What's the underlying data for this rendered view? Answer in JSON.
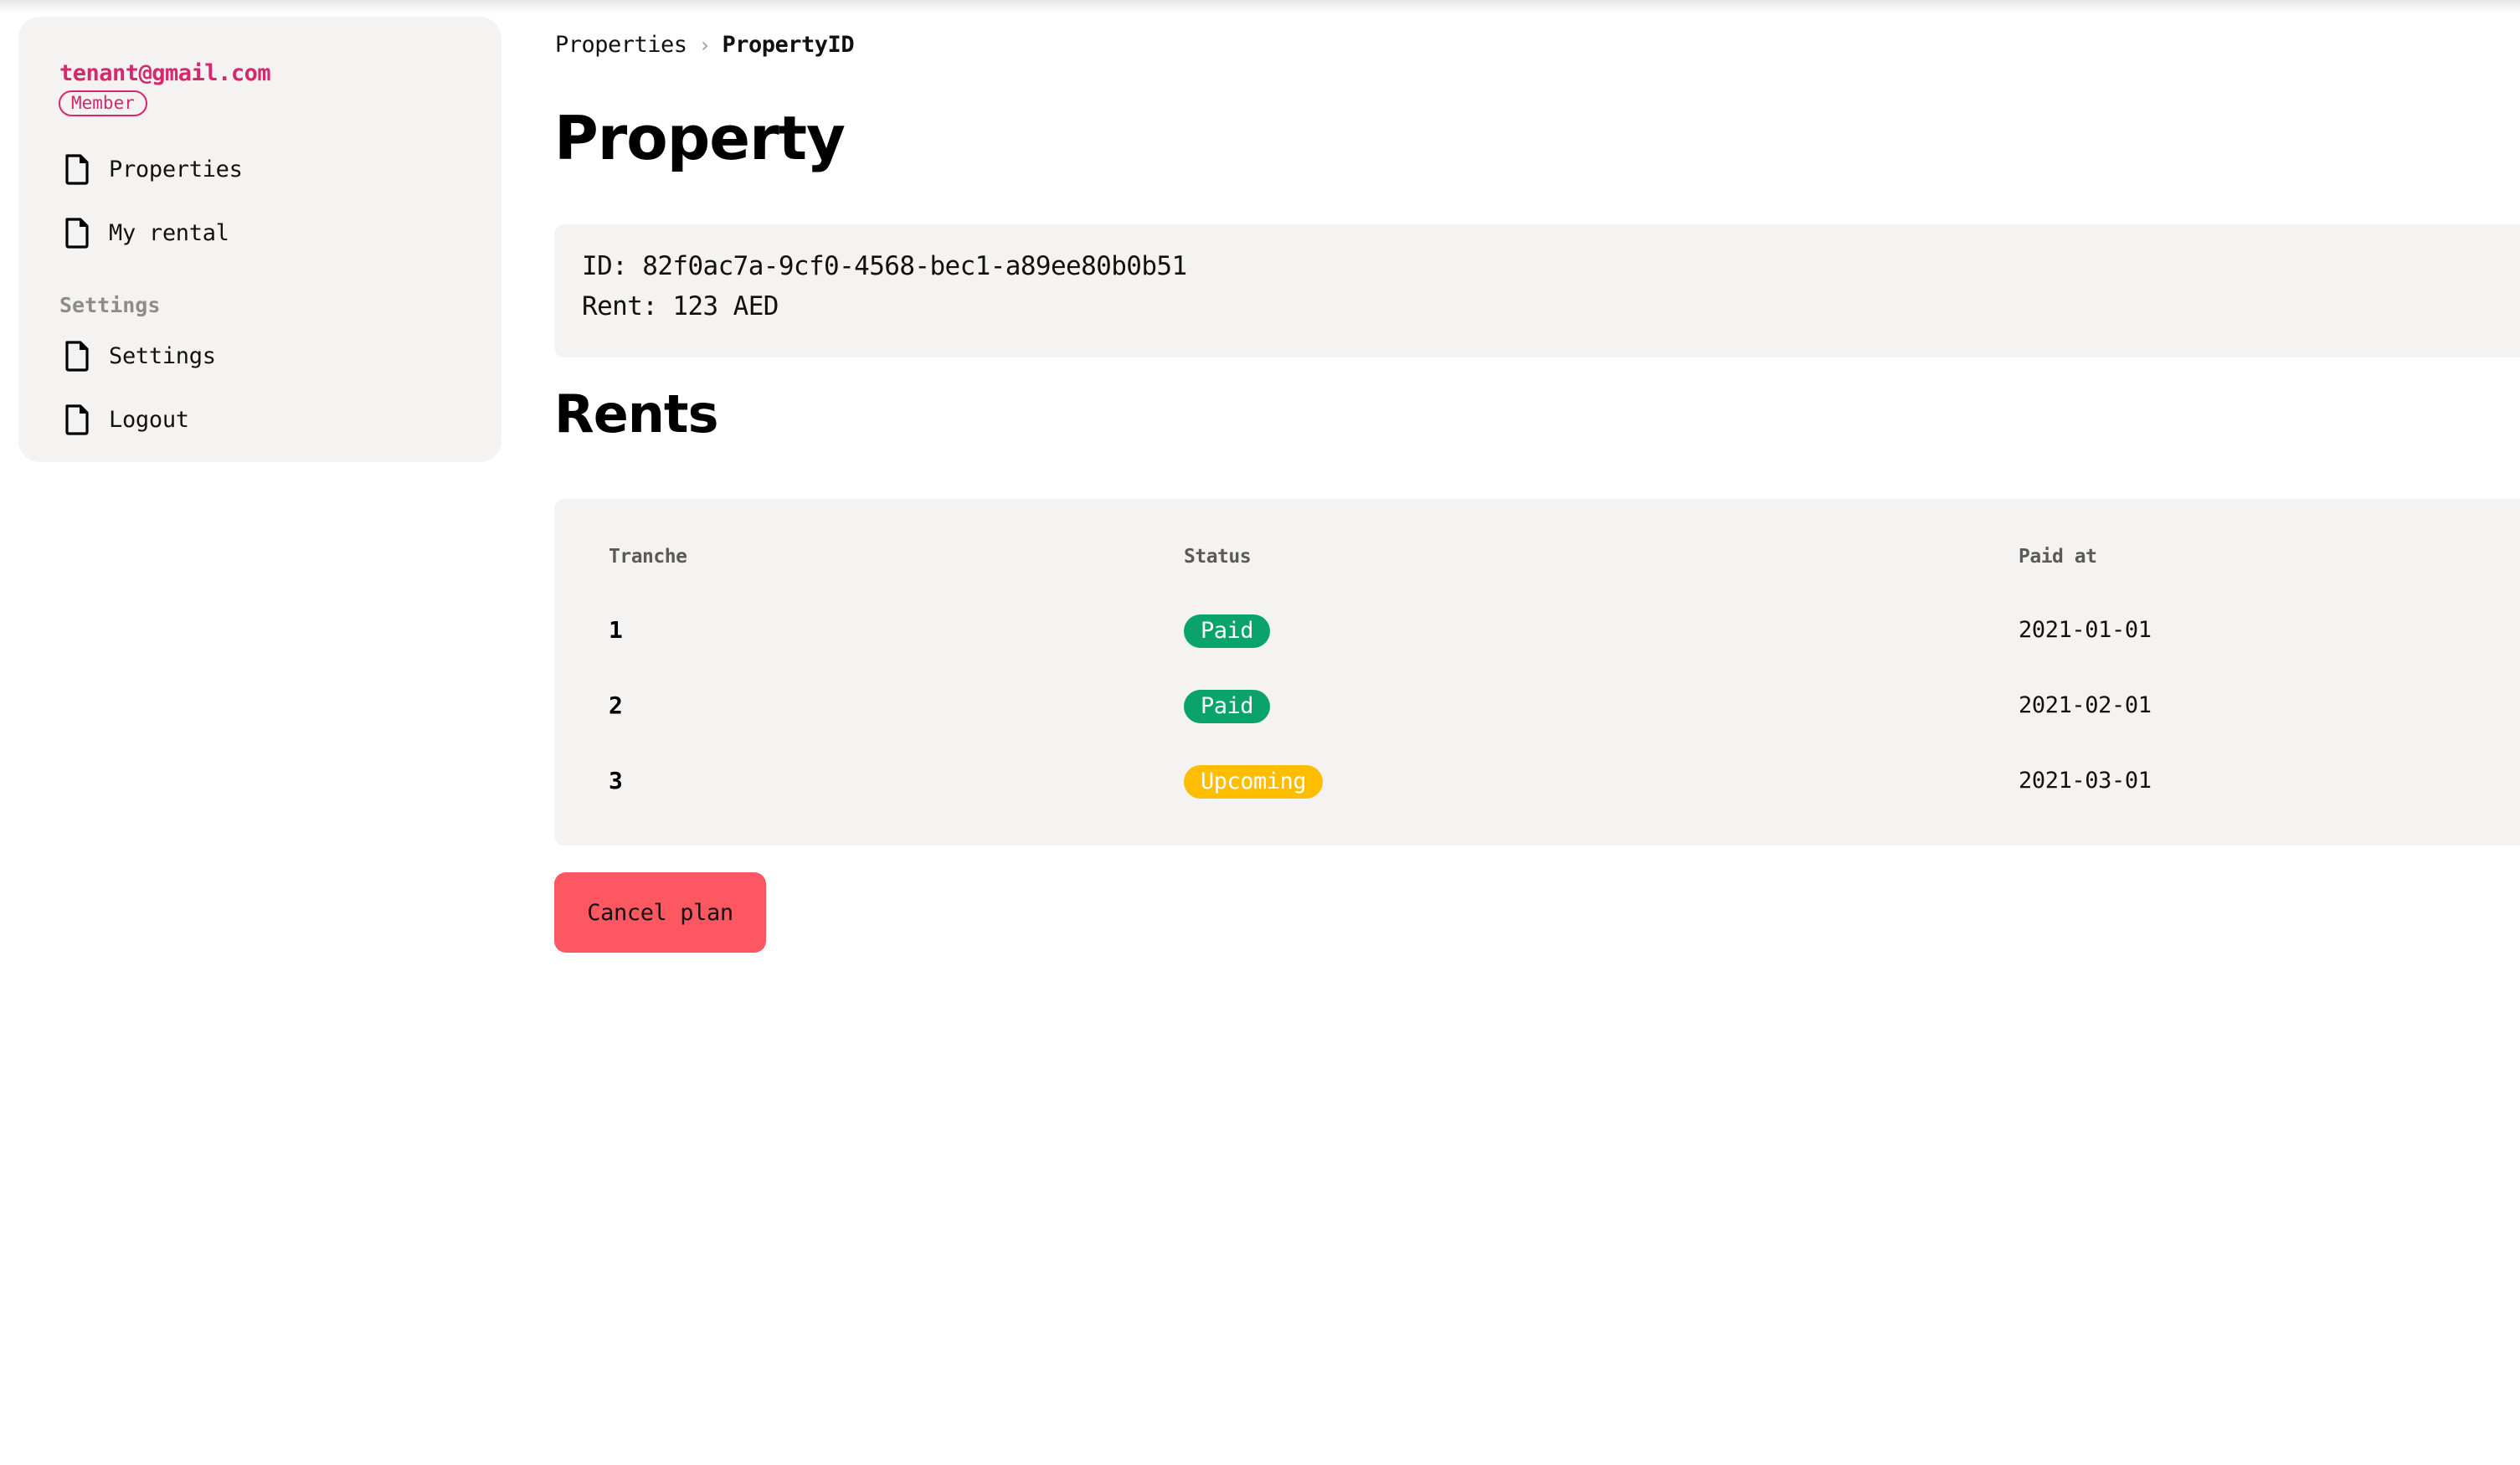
{
  "sidebar": {
    "user_email": "tenant@gmail.com",
    "role_badge": "Member",
    "items": [
      {
        "label": "Properties",
        "icon": "file-icon"
      },
      {
        "label": "My rental",
        "icon": "file-icon"
      }
    ],
    "settings_section": {
      "heading": "Settings",
      "items": [
        {
          "label": "Settings",
          "icon": "file-icon"
        },
        {
          "label": "Logout",
          "icon": "file-icon"
        }
      ]
    }
  },
  "breadcrumb": {
    "items": [
      "Properties",
      "PropertyID"
    ],
    "separator": "›"
  },
  "page": {
    "title": "Property",
    "property_id_line": "ID: 82f0ac7a-9cf0-4568-bec1-a89ee80b0b51",
    "rent_line": "Rent: 123 AED"
  },
  "rents": {
    "title": "Rents",
    "columns": [
      "Tranche",
      "Status",
      "Paid at"
    ],
    "rows": [
      {
        "tranche": "1",
        "status": "Paid",
        "paid_at": "2021-01-01"
      },
      {
        "tranche": "2",
        "status": "Paid",
        "paid_at": "2021-02-01"
      },
      {
        "tranche": "3",
        "status": "Upcoming",
        "paid_at": "2021-03-01"
      }
    ]
  },
  "actions": {
    "cancel_plan_label": "Cancel plan"
  },
  "colors": {
    "accent_pink": "#d6286e",
    "paid_green": "#0aa36c",
    "upcoming_yellow": "#fdbd00",
    "danger_red": "#fd5762",
    "panel_bg": "#f4f3f1"
  }
}
